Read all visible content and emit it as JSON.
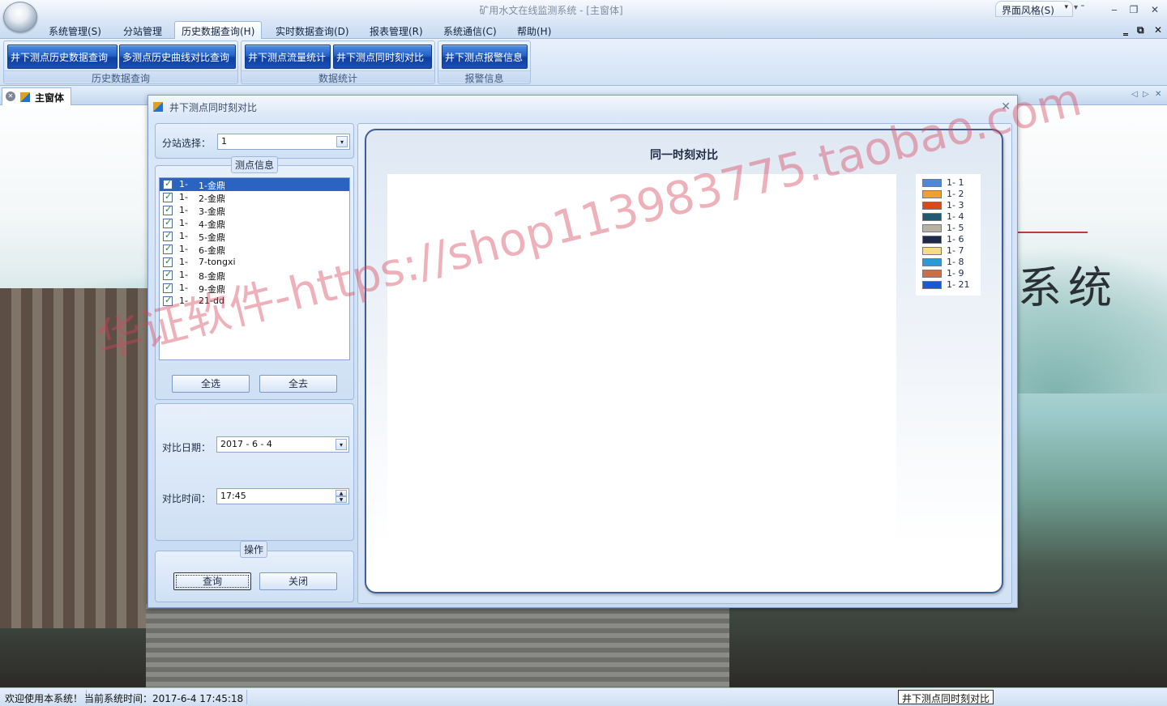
{
  "window": {
    "title": "矿用水文在线监测系统 - [主窗体]",
    "theme_menu": "界面风格(S)",
    "qat_more": "▾ ⁼",
    "controls": {
      "minimize": "‒",
      "restore": "❐",
      "close": "✕"
    },
    "mdi_controls": {
      "minimize": "‗",
      "restore": "⧉",
      "close": "✕"
    }
  },
  "ribbon": {
    "tabs": [
      {
        "label": "系统管理(S)"
      },
      {
        "label": "分站管理"
      },
      {
        "label": "历史数据查询(H)",
        "active": true
      },
      {
        "label": "实时数据查询(D)"
      },
      {
        "label": "报表管理(R)"
      },
      {
        "label": "系统通信(C)"
      },
      {
        "label": "帮助(H)"
      }
    ],
    "groups": [
      {
        "label": "历史数据查询",
        "buttons": [
          "井下测点历史数据查询",
          "多测点历史曲线对比查询"
        ]
      },
      {
        "label": "数据统计",
        "buttons": [
          "井下测点流量统计",
          "井下测点同时刻对比"
        ]
      },
      {
        "label": "报警信息",
        "buttons": [
          "井下测点报警信息"
        ]
      }
    ]
  },
  "mdi": {
    "tab_label": "主窗体",
    "close_glyph": "✕",
    "nav": {
      "prev": "◁",
      "next": "▷",
      "close": "✕"
    }
  },
  "background": {
    "title_char": "系统"
  },
  "dialog": {
    "title": "井下测点同时刻对比",
    "close": "✕",
    "station_label": "分站选择：",
    "station_value": "1",
    "combo_arrow": "▾",
    "points_caption": "测点信息",
    "points": [
      {
        "id": "1-",
        "name": "1-金鼎",
        "selected": true
      },
      {
        "id": "1-",
        "name": "2-金鼎"
      },
      {
        "id": "1-",
        "name": "3-金鼎"
      },
      {
        "id": "1-",
        "name": "4-金鼎"
      },
      {
        "id": "1-",
        "name": "5-金鼎"
      },
      {
        "id": "1-",
        "name": "6-金鼎"
      },
      {
        "id": "1-",
        "name": "7-tongxi"
      },
      {
        "id": "1-",
        "name": "8-金鼎"
      },
      {
        "id": "1-",
        "name": "9-金鼎"
      },
      {
        "id": "1-",
        "name": "21-dd"
      }
    ],
    "select_all": "全选",
    "deselect_all": "全去",
    "date_label": "对比日期：",
    "date_value": "2017 - 6 - 4",
    "time_label": "对比时间：",
    "time_value": "17:45",
    "spin_up": "▲",
    "spin_down": "▼",
    "ops_caption": "操作",
    "query": "查询",
    "close_btn": "关闭"
  },
  "chart_data": {
    "type": "bar",
    "title": "同一时刻对比",
    "categories": [],
    "series": [
      {
        "name": "1- 1",
        "color": "#4a8ad8",
        "values": []
      },
      {
        "name": "1- 2",
        "color": "#f0a030",
        "values": []
      },
      {
        "name": "1- 3",
        "color": "#d84818",
        "values": []
      },
      {
        "name": "1- 4",
        "color": "#205a70",
        "values": []
      },
      {
        "name": "1- 5",
        "color": "#b8b0a0",
        "values": []
      },
      {
        "name": "1- 6",
        "color": "#1c2a4a",
        "values": []
      },
      {
        "name": "1- 7",
        "color": "#f6dc88",
        "values": []
      },
      {
        "name": "1- 8",
        "color": "#2a9ad8",
        "values": []
      },
      {
        "name": "1- 9",
        "color": "#c87048",
        "values": []
      },
      {
        "name": "1- 21",
        "color": "#1a5ad0",
        "values": []
      }
    ],
    "legend": "right",
    "grid": false
  },
  "status": {
    "welcome": "欢迎使用本系统！",
    "time": "当前系统时间：2017-6-4 17:45:18",
    "task": "井下测点同时刻对比"
  },
  "watermark": "华证软件-https://shop113983775.taobao.com"
}
